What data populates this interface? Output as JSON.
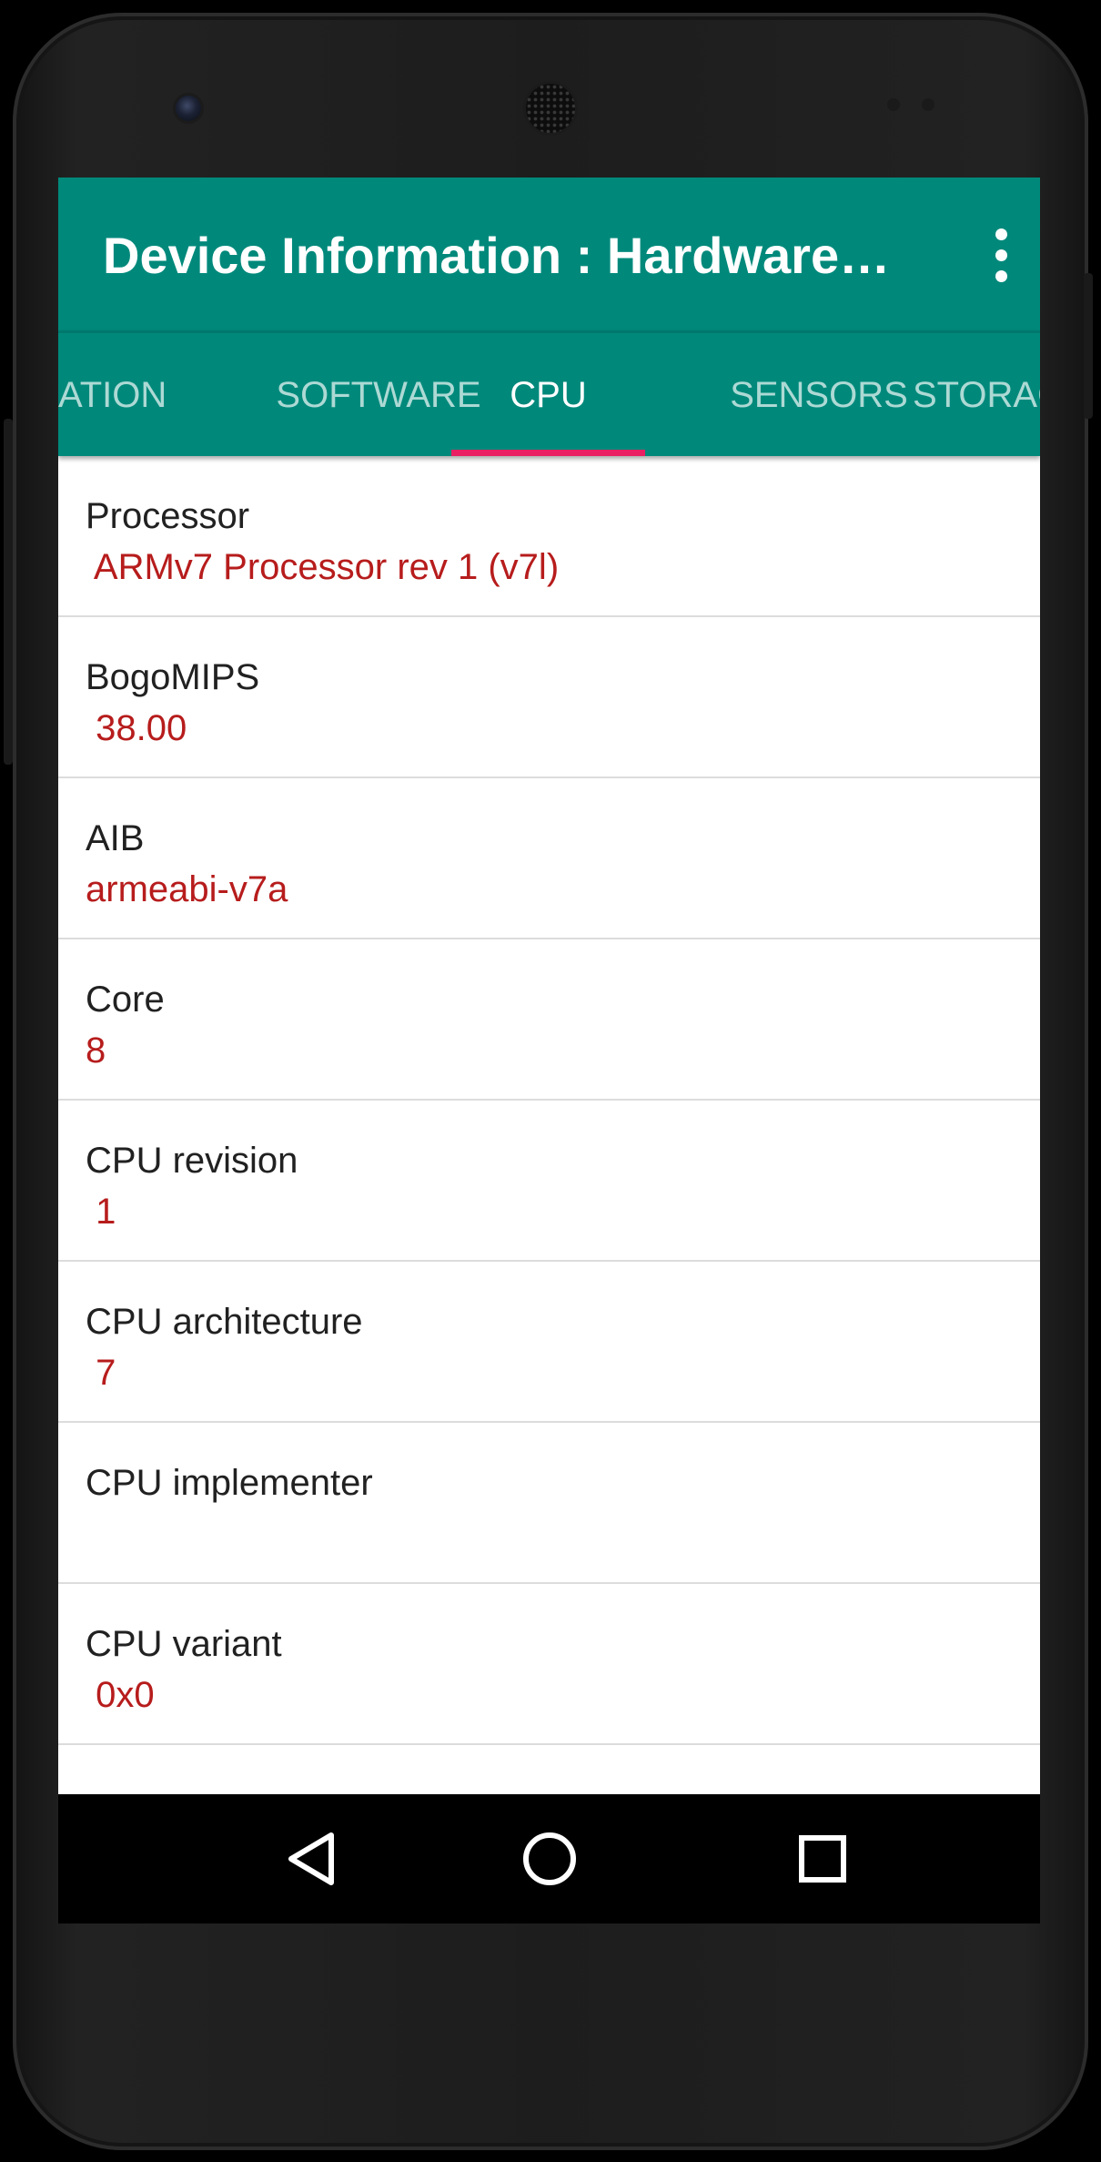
{
  "app_bar": {
    "title": "Device Information : Hardware…",
    "overflow_icon": "more-vert-icon"
  },
  "tabs": [
    {
      "label": "ATION",
      "active": false
    },
    {
      "label": "SOFTWARE",
      "active": false
    },
    {
      "label": "CPU",
      "active": true
    },
    {
      "label": "SENSORS",
      "active": false
    },
    {
      "label": "STORAG",
      "active": false
    }
  ],
  "rows": [
    {
      "label": "Processor",
      "value": " ARMv7 Processor rev 1 (v7l)"
    },
    {
      "label": "BogoMIPS",
      "value": " 38.00"
    },
    {
      "label": "AIB",
      "value": "armeabi-v7a"
    },
    {
      "label": "Core",
      "value": "8"
    },
    {
      "label": "CPU revision",
      "value": " 1"
    },
    {
      "label": "CPU architecture",
      "value": " 7"
    },
    {
      "label": "CPU implementer",
      "value": ""
    },
    {
      "label": "CPU variant",
      "value": " 0x0"
    }
  ],
  "nav_bar": {
    "back_icon": "back-triangle-icon",
    "home_icon": "home-circle-icon",
    "recents_icon": "recents-square-icon"
  },
  "colors": {
    "primary": "#00897b",
    "tab_indicator": "#e91e63",
    "value_text": "#b71c1c",
    "label_text": "#212121"
  }
}
